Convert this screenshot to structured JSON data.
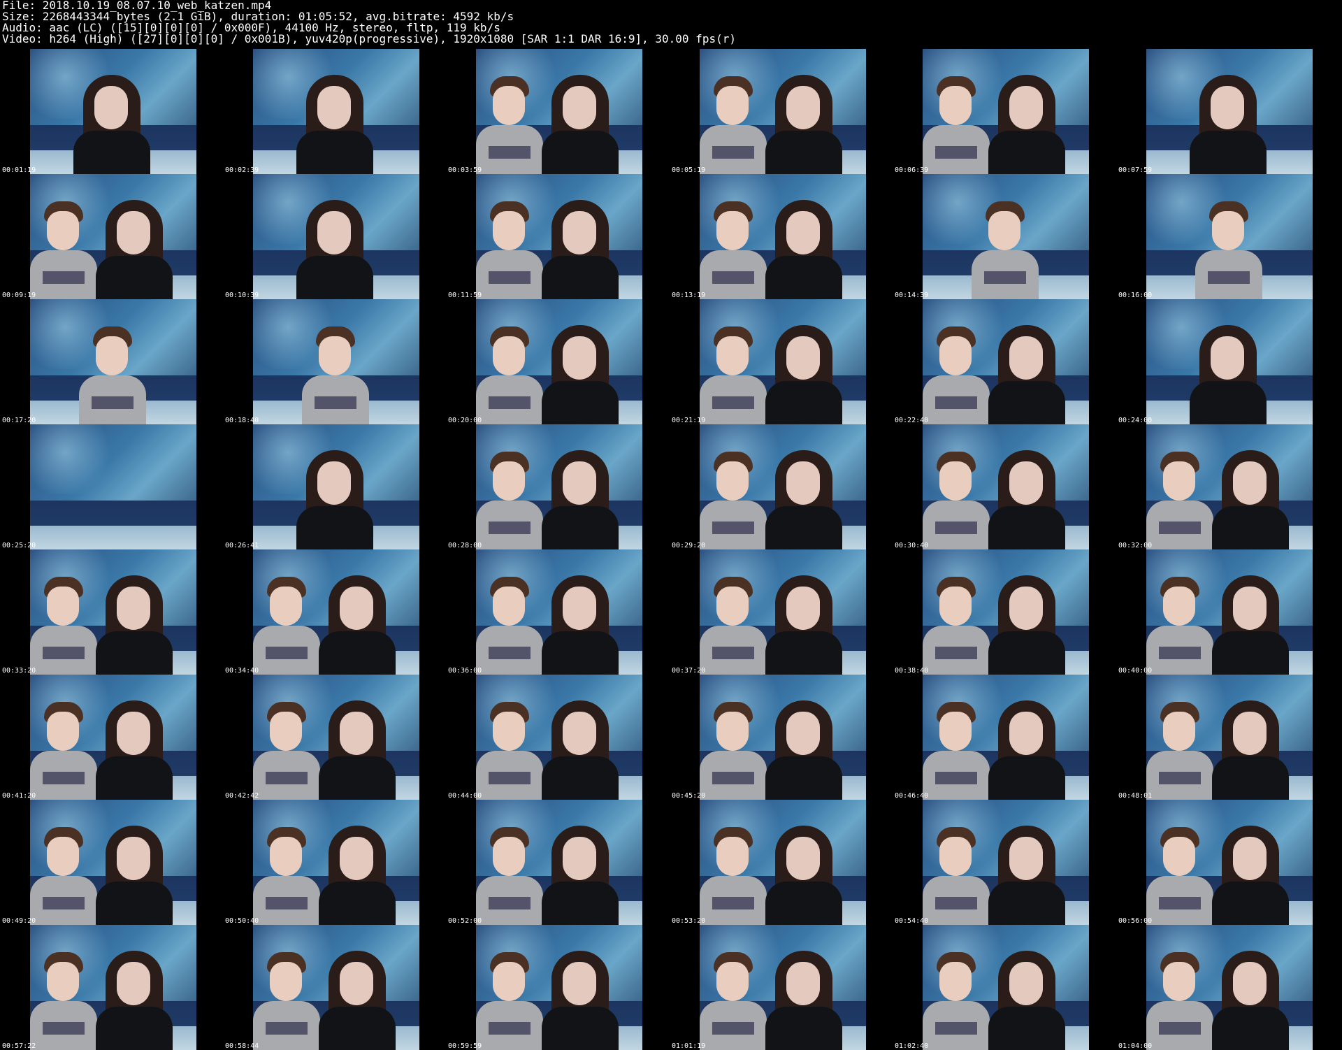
{
  "header": {
    "file_line": "File: 2018.10.19_08.07.10_web_katzen.mp4",
    "size_line": "Size: 2268443344 bytes (2.1 GiB), duration: 01:05:52, avg.bitrate: 4592 kb/s",
    "audio_line": "Audio: aac (LC) ([15][0][0][0] / 0x000F), 44100 Hz, stereo, fltp, 119 kb/s",
    "video_line": "Video: h264 (High) ([27][0][0][0] / 0x001B), yuv420p(progressive), 1920x1080 [SAR 1:1 DAR 16:9], 30.00 fps(r)"
  },
  "thumbnails": [
    {
      "time": "00:01:19",
      "boy": false
    },
    {
      "time": "00:02:39",
      "boy": false
    },
    {
      "time": "00:03:59",
      "boy": true
    },
    {
      "time": "00:05:19",
      "boy": true
    },
    {
      "time": "00:06:39",
      "boy": true
    },
    {
      "time": "00:07:59",
      "boy": false
    },
    {
      "time": "00:09:19",
      "boy": true
    },
    {
      "time": "00:10:39",
      "boy": false
    },
    {
      "time": "00:11:59",
      "boy": true
    },
    {
      "time": "00:13:19",
      "boy": true
    },
    {
      "time": "00:14:39",
      "boy": true,
      "boy_only": true
    },
    {
      "time": "00:16:00",
      "boy": true,
      "boy_only": true
    },
    {
      "time": "00:17:20",
      "boy": true,
      "boy_only": true
    },
    {
      "time": "00:18:40",
      "boy": true,
      "boy_only": true
    },
    {
      "time": "00:20:00",
      "boy": true
    },
    {
      "time": "00:21:19",
      "boy": true
    },
    {
      "time": "00:22:40",
      "boy": true
    },
    {
      "time": "00:24:00",
      "boy": false
    },
    {
      "time": "00:25:20",
      "boy": false,
      "empty": true
    },
    {
      "time": "00:26:41",
      "boy": false
    },
    {
      "time": "00:28:00",
      "boy": true
    },
    {
      "time": "00:29:20",
      "boy": true
    },
    {
      "time": "00:30:40",
      "boy": true
    },
    {
      "time": "00:32:00",
      "boy": true
    },
    {
      "time": "00:33:20",
      "boy": true
    },
    {
      "time": "00:34:40",
      "boy": true
    },
    {
      "time": "00:36:00",
      "boy": true
    },
    {
      "time": "00:37:20",
      "boy": true
    },
    {
      "time": "00:38:40",
      "boy": true
    },
    {
      "time": "00:40:00",
      "boy": true
    },
    {
      "time": "00:41:20",
      "boy": true
    },
    {
      "time": "00:42:42",
      "boy": true
    },
    {
      "time": "00:44:00",
      "boy": true
    },
    {
      "time": "00:45:20",
      "boy": true
    },
    {
      "time": "00:46:40",
      "boy": true
    },
    {
      "time": "00:48:01",
      "boy": true
    },
    {
      "time": "00:49:20",
      "boy": true
    },
    {
      "time": "00:50:40",
      "boy": true
    },
    {
      "time": "00:52:00",
      "boy": true
    },
    {
      "time": "00:53:20",
      "boy": true
    },
    {
      "time": "00:54:40",
      "boy": true
    },
    {
      "time": "00:56:00",
      "boy": true
    },
    {
      "time": "00:57:22",
      "boy": true
    },
    {
      "time": "00:58:44",
      "boy": true
    },
    {
      "time": "00:59:59",
      "boy": true
    },
    {
      "time": "01:01:19",
      "boy": true
    },
    {
      "time": "01:02:40",
      "boy": true
    },
    {
      "time": "01:04:00",
      "boy": true
    }
  ],
  "colors": {
    "background": "#000000",
    "text": "#ffffff"
  }
}
